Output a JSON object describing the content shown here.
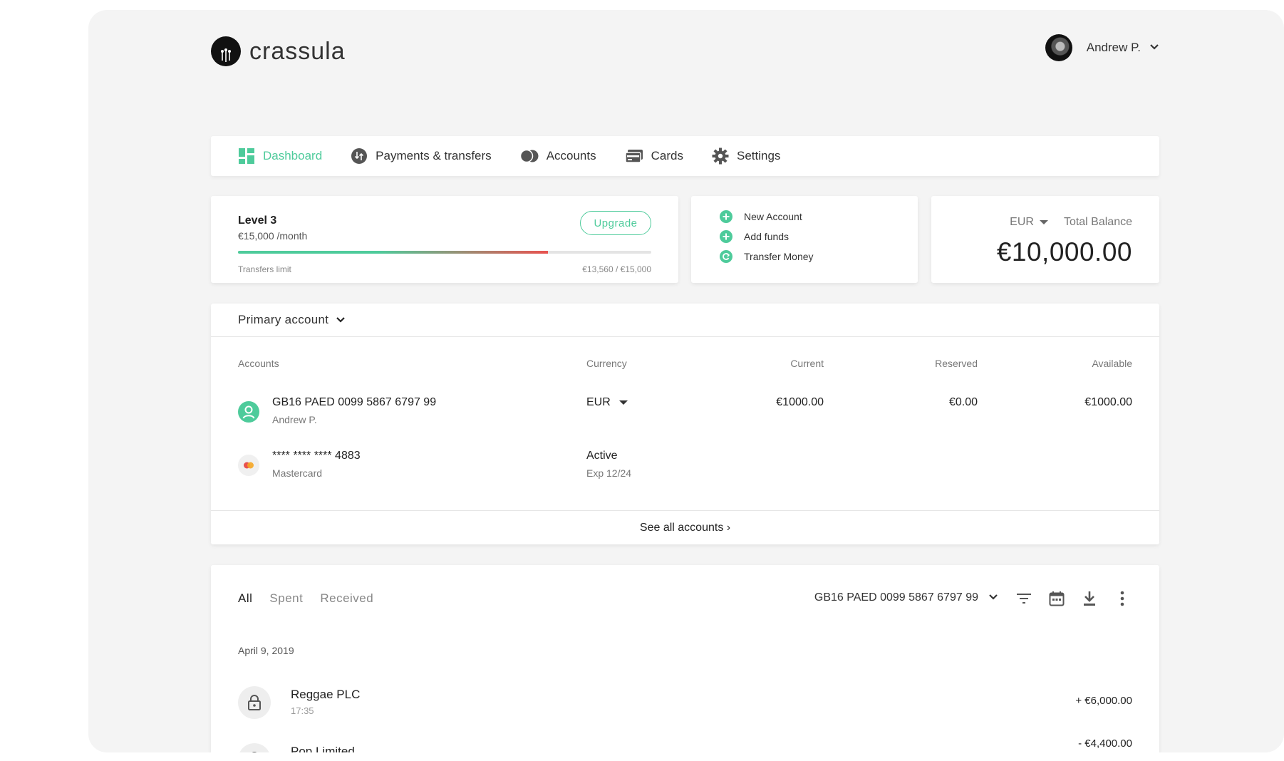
{
  "brand": {
    "name": "crassula"
  },
  "user": {
    "name": "Andrew P."
  },
  "nav": {
    "items": [
      {
        "label": "Dashboard",
        "icon": "dashboard-icon",
        "active": true
      },
      {
        "label": "Payments & transfers",
        "icon": "payments-icon"
      },
      {
        "label": "Accounts",
        "icon": "accounts-icon"
      },
      {
        "label": "Cards",
        "icon": "cards-icon"
      },
      {
        "label": "Settings",
        "icon": "gear-icon"
      }
    ]
  },
  "level": {
    "title": "Level 3",
    "subtitle": "€15,000 /month",
    "upgrade_label": "Upgrade",
    "limit_label": "Transfers limit",
    "limit_value": "€13,560 / €15,000",
    "limit_progress": 0.75
  },
  "actions": [
    {
      "label": "New Account",
      "icon": "plus-circle-icon"
    },
    {
      "label": "Add funds",
      "icon": "plus-circle-icon"
    },
    {
      "label": "Transfer Money",
      "icon": "transfer-icon"
    }
  ],
  "balance": {
    "currency": "EUR",
    "label": "Total Balance",
    "value": "€10,000.00"
  },
  "accounts_panel": {
    "selector": "Primary account",
    "columns": {
      "accounts": "Accounts",
      "currency": "Currency",
      "current": "Current",
      "reserved": "Reserved",
      "available": "Available"
    },
    "account": {
      "iban": "GB16 PAED 0099 5867 6797 99",
      "holder": "Andrew P.",
      "currency": "EUR",
      "current": "€1000.00",
      "reserved": "€0.00",
      "available": "€1000.00"
    },
    "card": {
      "number": "**** **** **** 4883",
      "brand": "Mastercard",
      "status": "Active",
      "expiry": "Exp 12/24"
    },
    "see_all": "See all accounts ›"
  },
  "transactions": {
    "tabs": [
      {
        "label": "All",
        "active": true
      },
      {
        "label": "Spent"
      },
      {
        "label": "Received"
      }
    ],
    "account_filter": "GB16 PAED 0099 5867 6797 99",
    "date": "April 9, 2019",
    "items": [
      {
        "name": "Reggae PLC",
        "time": "17:35",
        "amount": "+ €6,000.00"
      },
      {
        "name": "Pop Limited",
        "time": "",
        "amount": "- €4,400.00"
      }
    ]
  },
  "colors": {
    "accent": "#4ecb9b",
    "danger": "#e8524f"
  }
}
